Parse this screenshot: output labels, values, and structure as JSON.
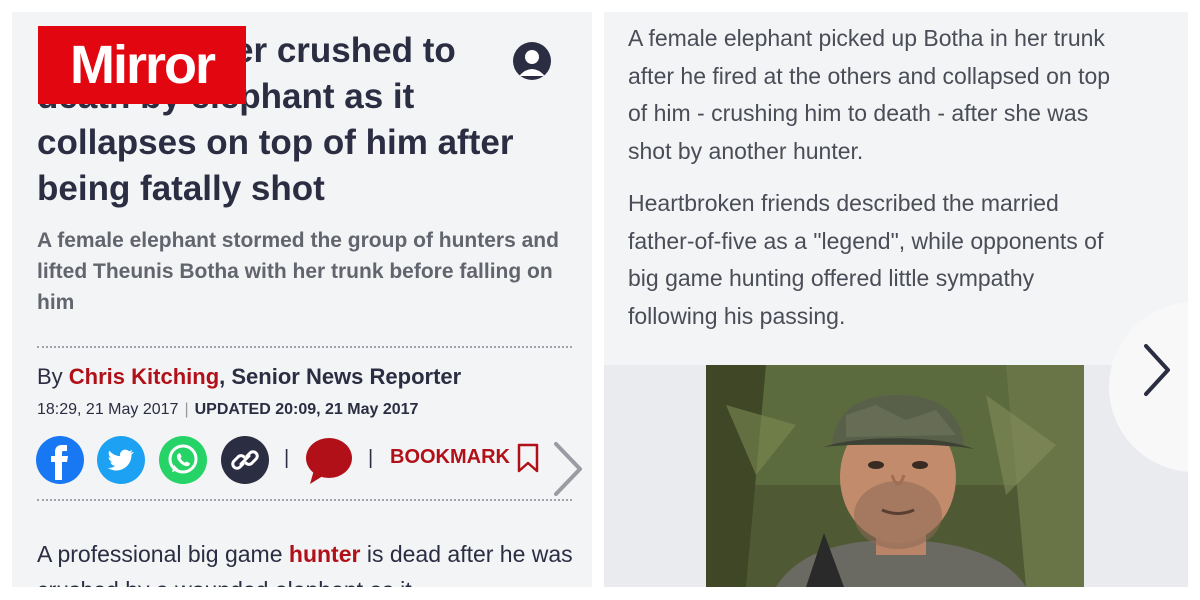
{
  "brand": {
    "name": "Mirror",
    "color": "#e1060f"
  },
  "header": {
    "account_icon": "account-icon"
  },
  "article": {
    "headline": {
      "line1": "nter crushed to",
      "line2": "death by elephant as it",
      "line3": "collapses on top of him after",
      "line4": "being fatally shot"
    },
    "subheading": "A female elephant stormed the group of hunters and lifted Theunis Botha with her trunk before falling on him",
    "byline": {
      "prefix": "By ",
      "author": "Chris Kitching",
      "role": ", Senior News Reporter"
    },
    "published": "18:29, 21 May 2017",
    "separator": "|",
    "updated": "UPDATED 20:09, 21 May 2017",
    "body_start": "A professional big game ",
    "body_link": "hunter",
    "body_end": " is dead after he was crushed by a wounded elephant as it"
  },
  "share": {
    "icons": [
      "facebook-icon",
      "twitter-icon",
      "whatsapp-icon",
      "link-icon",
      "comment-icon"
    ],
    "pipe": "|",
    "bookmark_label": "BOOKMARK"
  },
  "right_panel": {
    "paragraph1": "A female elephant picked up Botha in her trunk after he fired at the others and collapsed on top of him - crushing him to death - after she was shot by another hunter.",
    "paragraph2": "Heartbroken friends described the married father-of-five as a \"legend\", while opponents of big game hunting offered little sympathy following his passing."
  },
  "colors": {
    "link": "#b21018",
    "text": "#2b2d42",
    "panel": "#f3f4f5"
  }
}
